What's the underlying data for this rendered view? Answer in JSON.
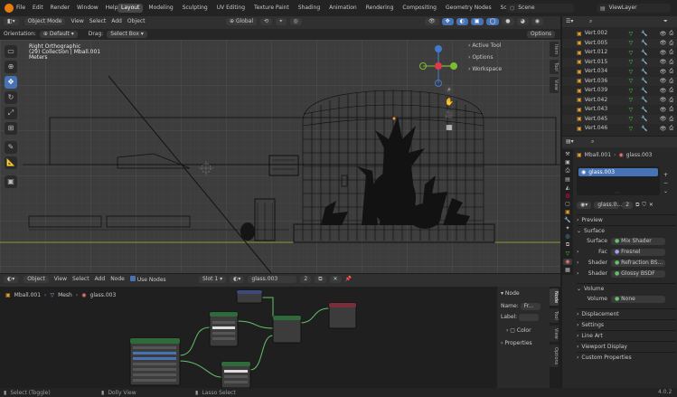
{
  "topbar": {
    "menus": [
      "File",
      "Edit",
      "Render",
      "Window",
      "Help"
    ],
    "workspaces": [
      "Layout",
      "Modeling",
      "Sculpting",
      "UV Editing",
      "Texture Paint",
      "Shading",
      "Animation",
      "Rendering",
      "Compositing",
      "Geometry Nodes",
      "Scripting"
    ],
    "active_workspace": "Layout",
    "scene_label": "Scene",
    "viewlayer_label": "ViewLayer"
  },
  "viewport_header": {
    "mode": "Object Mode",
    "menus": [
      "View",
      "Select",
      "Add",
      "Object"
    ],
    "transform": "Global"
  },
  "tool_settings": {
    "orientation_label": "Orientation:",
    "orientation_value": "Default",
    "drag_label": "Drag:",
    "drag_value": "Select Box",
    "options": "Options"
  },
  "viewport_info": {
    "view_name": "Right Orthographic",
    "collection": "(29) Collection | Mball.001",
    "units": "Meters"
  },
  "viewport_panels": [
    "Active Tool",
    "Options",
    "Workspace"
  ],
  "viewport_vtabs": [
    "Item",
    "Tool",
    "View"
  ],
  "outliner": {
    "items": [
      "Vert.002",
      "Vert.005",
      "Vert.012",
      "Vert.015",
      "Vert.034",
      "Vert.036",
      "Vert.039",
      "Vert.042",
      "Vert.043",
      "Vert.045",
      "Vert.046"
    ]
  },
  "node_header": {
    "menus": [
      "View",
      "Select",
      "Add",
      "Node"
    ],
    "type": "Object",
    "use_nodes": "Use Nodes",
    "slot": "Slot 1",
    "material": "glass.003",
    "users": "2"
  },
  "node_breadcrumb": {
    "object": "Mball.001",
    "mesh": "Mesh",
    "material": "glass.003"
  },
  "node_sidebar": {
    "section": "Node",
    "name_label": "Name:",
    "name_value": "Fr...",
    "label_label": "Label:",
    "color": "Color",
    "properties": "Properties",
    "vtabs": [
      "Node",
      "Tool",
      "View",
      "Options"
    ]
  },
  "properties": {
    "object": "Mball.001",
    "material": "glass.003",
    "slot_item": "glass.003",
    "material_field": "glass.0...",
    "preview": "Preview",
    "surface": "Surface",
    "surface_label": "Surface",
    "surface_value": "Mix Shader",
    "fac_label": "Fac",
    "fac_value": "Fresnel",
    "shader1_label": "Shader",
    "shader1_value": "Refraction BS...",
    "shader2_label": "Shader",
    "shader2_value": "Glossy BSDF",
    "volume": "Volume",
    "volume_label": "Volume",
    "volume_value": "None",
    "displacement": "Displacement",
    "settings": "Settings",
    "line_art": "Line Art",
    "viewport_display": "Viewport Display",
    "custom_properties": "Custom Properties"
  },
  "statusbar": {
    "select": "Select (Toggle)",
    "dolly": "Dolly View",
    "lasso": "Lasso Select",
    "version": "4.0.2"
  },
  "colors": {
    "accent_blue": "#4772b3",
    "wire": "#0a0a0a",
    "grid_bg": "#3d3d3d",
    "node_green": "#2f6b3a",
    "node_red": "#7a2e3a",
    "shader_green": "#63c26b"
  }
}
